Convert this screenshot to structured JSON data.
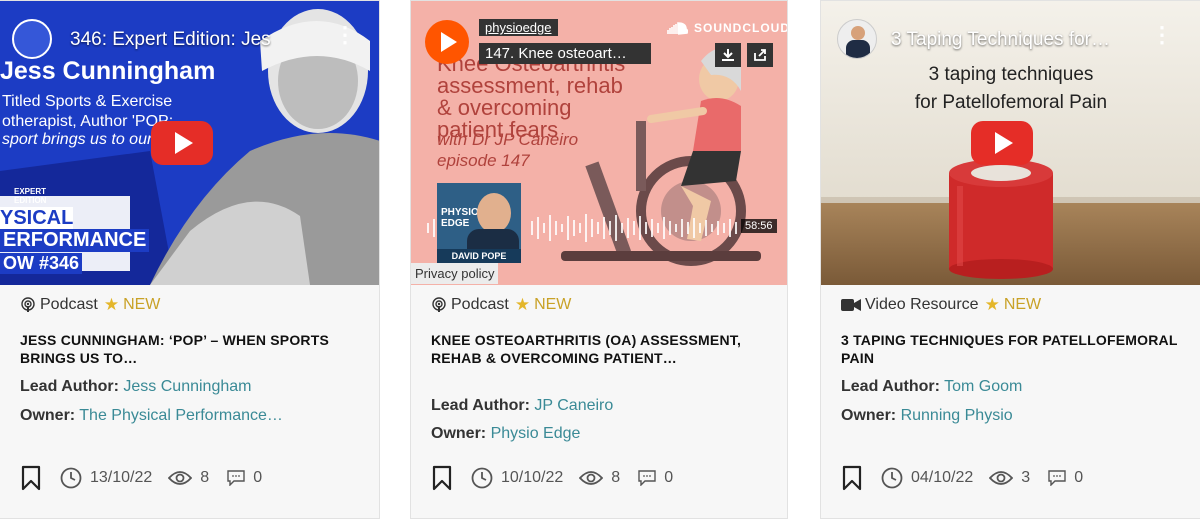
{
  "cards": [
    {
      "thumb": {
        "video_title": "346: Expert Edition: Jes",
        "overlay_name": "Jess Cunningham",
        "overlay_line1": "Titled Sports & Exercise",
        "overlay_line2": "otherapist, Author 'POP:",
        "overlay_line3": "sport brings us to our",
        "badge_small": "EXPERT EDITION",
        "badge_l1": "YSICAL",
        "badge_l2": "ERFORMANCE",
        "badge_l3": "OW #346"
      },
      "type": "Podcast",
      "type_icon": "podcast-icon",
      "new_label": "NEW",
      "title": "JESS CUNNINGHAM: ‘POP’ – WHEN SPORTS BRINGS US TO…",
      "lead_author_label": "Lead Author:",
      "lead_author": "Jess Cunningham",
      "owner_label": "Owner:",
      "owner": "The Physical Performance…",
      "date": "13/10/22",
      "views": "8",
      "comments": "0"
    },
    {
      "thumb": {
        "user": "physioedge",
        "track": "147. Knee osteoart…",
        "brand": "SOUNDCLOUD",
        "art_line1": "Knee Osteoarthritis",
        "art_line2": "assessment, rehab",
        "art_line3": "& overcoming",
        "art_line4": "patient fears",
        "art_line5": "with Dr JP Caneiro",
        "art_line6": "episode 147",
        "logo_text": "PHYSIO EDGE",
        "host": "DAVID POPE",
        "duration": "58:56",
        "privacy": "Privacy policy"
      },
      "type": "Podcast",
      "type_icon": "podcast-icon",
      "new_label": "NEW",
      "title": "KNEE OSTEOARTHRITIS (OA) ASSESSMENT, REHAB & OVERCOMING PATIENT…",
      "lead_author_label": "Lead Author:",
      "lead_author": "JP Caneiro",
      "owner_label": "Owner:",
      "owner": "Physio Edge",
      "date": "10/10/22",
      "views": "8",
      "comments": "0"
    },
    {
      "thumb": {
        "video_title": "3 Taping Techniques for…",
        "caption_l1": "3 taping techniques",
        "caption_l2": "for Patellofemoral Pain"
      },
      "type": "Video Resource",
      "type_icon": "video-camera-icon",
      "new_label": "NEW",
      "title": "3 TAPING TECHNIQUES FOR PATELLOFEMORAL PAIN",
      "lead_author_label": "Lead Author:",
      "lead_author": "Tom Goom",
      "owner_label": "Owner:",
      "owner": "Running Physio",
      "date": "04/10/22",
      "views": "3",
      "comments": "0"
    }
  ],
  "colors": {
    "accent_link": "#3a8a96",
    "new_badge": "#c9a227",
    "youtube_red": "#e52d27",
    "soundcloud_orange": "#ff5500",
    "podcast_bg": "#f4b1a8"
  }
}
